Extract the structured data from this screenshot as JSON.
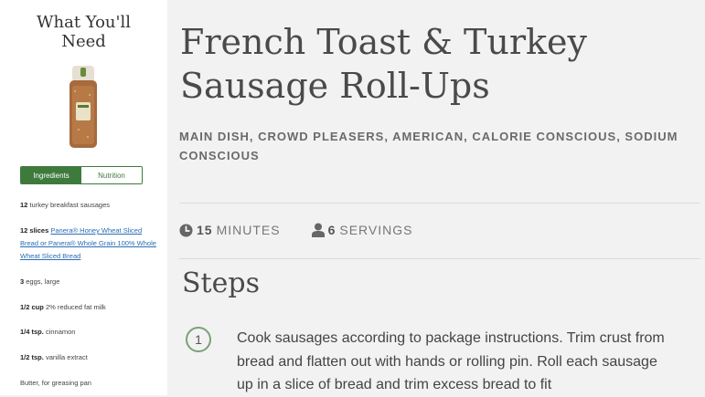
{
  "sidebar": {
    "title_line1": "What You'll",
    "title_line2": "Need",
    "product_image_icon": "bread-loaf-icon",
    "tabs": [
      {
        "label": "Ingredients",
        "active": true
      },
      {
        "label": "Nutrition",
        "active": false
      }
    ],
    "ingredients": [
      {
        "qty": "12",
        "text": "turkey breakfast sausages"
      },
      {
        "qty": "12 slices",
        "link1": "Panera® Honey Wheat Sliced Bread or Panera® Whole Grain 100% Whole Wheat Sliced Bread"
      },
      {
        "qty": "3",
        "text": "eggs, large"
      },
      {
        "qty": "1/2 cup",
        "text": "2% reduced fat milk"
      },
      {
        "qty": "1/4 tsp.",
        "text": "cinnamon"
      },
      {
        "qty": "1/2 tsp.",
        "text": "vanilla extract"
      },
      {
        "qty": "",
        "text": "Butter, for greasing pan"
      }
    ]
  },
  "recipe": {
    "title": "French Toast & Turkey Sausage Roll-Ups",
    "categories": "MAIN DISH, CROWD PLEASERS, AMERICAN, CALORIE CONSCIOUS, SODIUM CONSCIOUS",
    "time_value": "15",
    "time_unit": "MINUTES",
    "servings_value": "6",
    "servings_unit": "SERVINGS",
    "steps_heading": "Steps",
    "steps": [
      {
        "number": "1",
        "text": "Cook sausages according to package instructions.  Trim crust from bread and flatten out with hands or rolling pin.  Roll each sausage up in a slice of bread and trim excess bread to fit"
      }
    ]
  },
  "colors": {
    "accent": "#3e7a3c",
    "link": "#2a6db5"
  }
}
